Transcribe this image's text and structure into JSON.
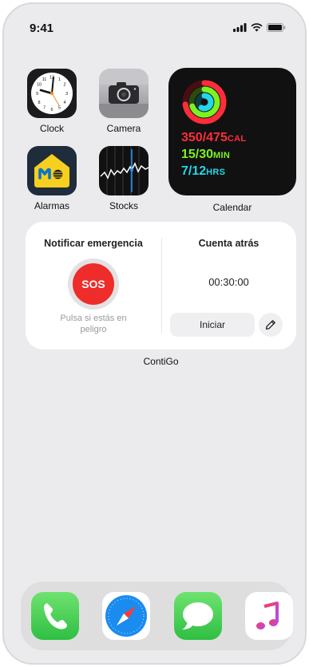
{
  "status_bar": {
    "time": "9:41",
    "icons": [
      "signal-icon",
      "wifi-icon",
      "battery-icon"
    ]
  },
  "apps": {
    "clock": {
      "label": "Clock",
      "icon": "clock-icon"
    },
    "camera": {
      "label": "Camera",
      "icon": "camera-icon"
    },
    "alarmas": {
      "label": "Alarmas",
      "icon": "movistar-alarm-icon"
    },
    "stocks": {
      "label": "Stocks",
      "icon": "stocks-chart-icon"
    }
  },
  "activity_widget": {
    "label": "Calendar",
    "move": "350/475",
    "move_unit": "CAL",
    "exercise": "15/30",
    "exercise_unit": "MIN",
    "stand": "7/12",
    "stand_unit": "HRS",
    "colors": {
      "move": "#ff2d3a",
      "exercise": "#7cf321",
      "stand": "#23d6ea"
    }
  },
  "contigo_widget": {
    "label": "ContiGo",
    "emergency_title": "Notificar emergencia",
    "sos_label": "SOS",
    "sos_hint": "Pulsa si estás en peligro",
    "countdown_title": "Cuenta atrás",
    "countdown_time": "00:30:00",
    "start_label": "Iniciar",
    "edit_icon": "pencil-icon",
    "sos_color": "#ee2c29"
  },
  "dock": {
    "apps": [
      {
        "name": "Phone",
        "icon": "phone-icon",
        "color": "#4cd964"
      },
      {
        "name": "Safari",
        "icon": "compass-icon",
        "color": "#1a8cf0"
      },
      {
        "name": "Messages",
        "icon": "speech-bubble-icon",
        "color": "#4cd964"
      },
      {
        "name": "Music",
        "icon": "music-note-icon",
        "color": "#fa3c5a"
      }
    ]
  }
}
